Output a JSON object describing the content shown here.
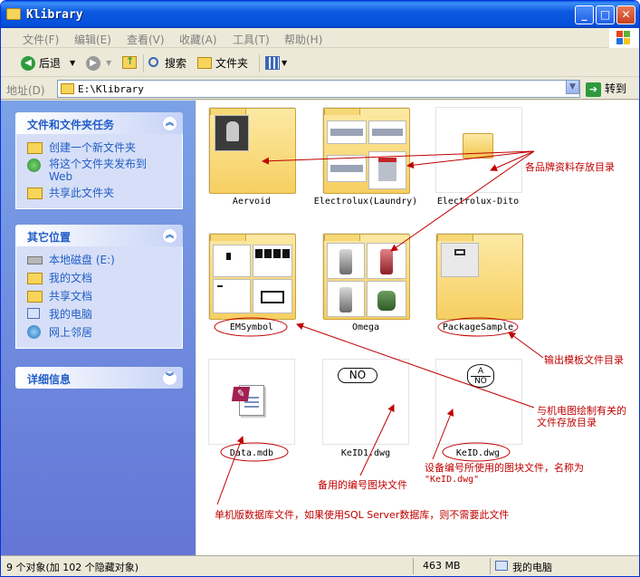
{
  "window": {
    "title": "Klibrary"
  },
  "menu": [
    "文件(F)",
    "编辑(E)",
    "查看(V)",
    "收藏(A)",
    "工具(T)",
    "帮助(H)"
  ],
  "toolbar": {
    "back": "后退",
    "search": "搜索",
    "folders": "文件夹"
  },
  "address": {
    "label": "地址(D)",
    "path": "E:\\Klibrary",
    "go": "转到"
  },
  "tasks": {
    "title": "文件和文件夹任务",
    "items": [
      "创建一个新文件夹",
      "将这个文件夹发布到",
      "Web",
      "共享此文件夹"
    ]
  },
  "other": {
    "title": "其它位置",
    "items": [
      "本地磁盘 (E:)",
      "我的文档",
      "共享文档",
      "我的电脑",
      "网上邻居"
    ]
  },
  "details": {
    "title": "详细信息"
  },
  "files": [
    {
      "name": "Aervoid"
    },
    {
      "name": "Electrolux(Laundry)"
    },
    {
      "name": "Electrolux-Dito"
    },
    {
      "name": "EMSymbol"
    },
    {
      "name": "Omega"
    },
    {
      "name": "PackageSample"
    },
    {
      "name": "Data.mdb"
    },
    {
      "name": "KeID1.dwg"
    },
    {
      "name": "KeID.dwg"
    }
  ],
  "thumb_text": {
    "no": "NO",
    "a": "A",
    "no2": "NO"
  },
  "annotations": {
    "brands": "各品牌资料存放目录",
    "template": "输出模板文件目录",
    "em_line1": "与机电图绘制有关的",
    "em_line2": "文件存放目录",
    "device_line1": "设备编号所使用的图块文件，名称为",
    "device_line2": "\"KeID.dwg\"",
    "spare": "备用的编号图块文件",
    "db": "单机版数据库文件，如果使用SQL Server数据库，则不需要此文件"
  },
  "status": {
    "objects": "9 个对象(加 102 个隐藏对象)",
    "size": "463 MB",
    "location": "我的电脑"
  },
  "colors": {
    "annotation": "#c00000",
    "titlebar": "#0c59e0",
    "link": "#215dc6"
  }
}
